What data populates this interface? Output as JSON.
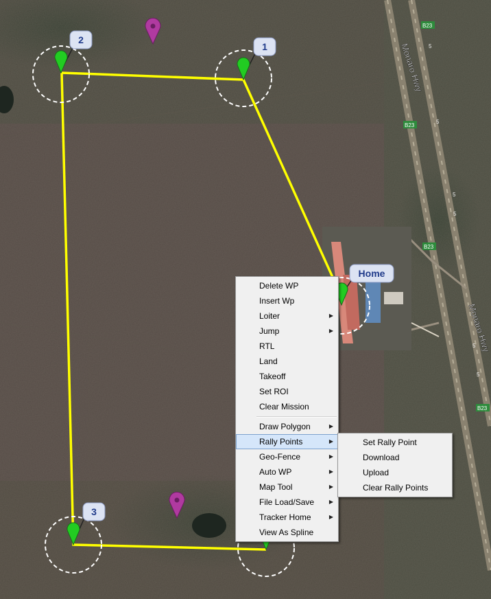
{
  "map": {
    "waypoints": [
      {
        "label": "1"
      },
      {
        "label": "2"
      },
      {
        "label": "3"
      },
      {
        "label": "Home"
      }
    ],
    "road_labels": [
      "Monaro Hwy",
      "Monaro Hwy"
    ],
    "road_shields": [
      "B23",
      "B23",
      "B23",
      "B23"
    ],
    "road_numbers": [
      "5",
      "5",
      "5",
      "5",
      "5",
      "5"
    ],
    "colors": {
      "route": "#ffff00",
      "marker_green": "#22cc22",
      "marker_purple": "#b03aa0",
      "callout_fill": "#dce3f3",
      "callout_text": "#1f3a8a",
      "road_shield": "#2e8b3c"
    }
  },
  "context_menu": {
    "items": [
      {
        "label": "Delete WP",
        "submenu": false
      },
      {
        "label": "Insert Wp",
        "submenu": false
      },
      {
        "label": "Loiter",
        "submenu": true
      },
      {
        "label": "Jump",
        "submenu": true
      },
      {
        "label": "RTL",
        "submenu": false
      },
      {
        "label": "Land",
        "submenu": false
      },
      {
        "label": "Takeoff",
        "submenu": false
      },
      {
        "label": "Set ROI",
        "submenu": false
      },
      {
        "label": "Clear Mission",
        "submenu": false
      },
      {
        "label": "Draw Polygon",
        "submenu": true
      },
      {
        "label": "Rally Points",
        "submenu": true,
        "highlighted": true
      },
      {
        "label": "Geo-Fence",
        "submenu": true
      },
      {
        "label": "Auto WP",
        "submenu": true
      },
      {
        "label": "Map Tool",
        "submenu": true
      },
      {
        "label": "File Load/Save",
        "submenu": true
      },
      {
        "label": "Tracker Home",
        "submenu": true
      },
      {
        "label": "View As Spline",
        "submenu": false
      }
    ],
    "submenu_arrow": "▶"
  },
  "rally_submenu": {
    "items": [
      {
        "label": "Set Rally Point"
      },
      {
        "label": "Download"
      },
      {
        "label": "Upload"
      },
      {
        "label": "Clear Rally Points"
      }
    ]
  }
}
